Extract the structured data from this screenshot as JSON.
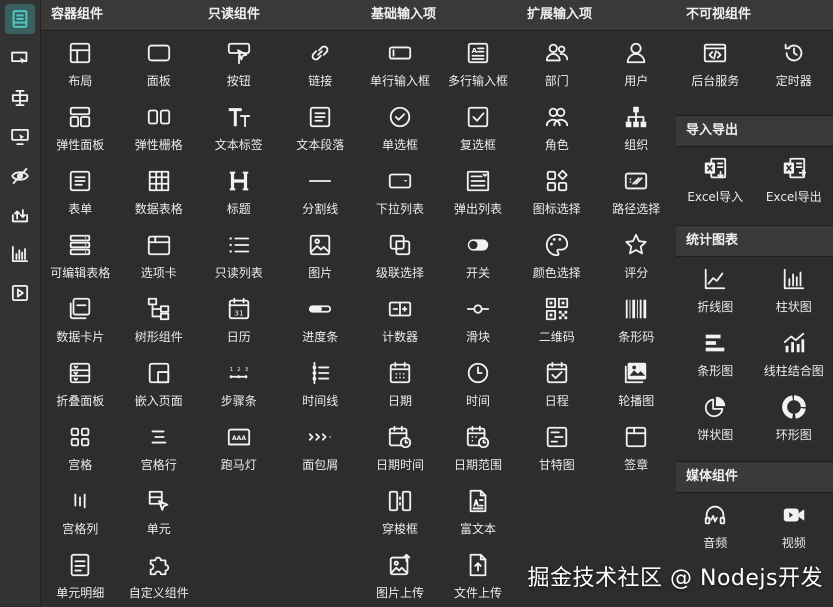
{
  "accent": "#4fc7c0",
  "rail": [
    {
      "icon": "form-designer-icon",
      "active": true
    },
    {
      "icon": "pointer-select-icon",
      "active": false
    },
    {
      "icon": "text-cursor-icon",
      "active": false
    },
    {
      "icon": "screen-click-icon",
      "active": false
    },
    {
      "icon": "eye-off-icon",
      "active": false
    },
    {
      "icon": "import-export-icon",
      "active": false
    },
    {
      "icon": "bar-chart-icon",
      "active": false
    },
    {
      "icon": "media-play-icon",
      "active": false
    }
  ],
  "sections": {
    "container": {
      "title": "容器组件",
      "items": [
        {
          "label": "布局",
          "icon": "layout-icon"
        },
        {
          "label": "面板",
          "icon": "panel-icon"
        },
        {
          "label": "弹性面板",
          "icon": "flex-panel-icon"
        },
        {
          "label": "弹性栅格",
          "icon": "flex-grid-icon"
        },
        {
          "label": "表单",
          "icon": "form-icon"
        },
        {
          "label": "数据表格",
          "icon": "data-table-icon"
        },
        {
          "label": "可编辑表格",
          "icon": "editable-table-icon"
        },
        {
          "label": "选项卡",
          "icon": "tabs-icon"
        },
        {
          "label": "数据卡片",
          "icon": "data-card-icon"
        },
        {
          "label": "树形组件",
          "icon": "tree-icon"
        },
        {
          "label": "折叠面板",
          "icon": "collapse-icon"
        },
        {
          "label": "嵌入页面",
          "icon": "embed-page-icon"
        },
        {
          "label": "宫格",
          "icon": "grid-cells-icon"
        },
        {
          "label": "宫格行",
          "icon": "grid-row-icon"
        },
        {
          "label": "宫格列",
          "icon": "grid-column-icon"
        },
        {
          "label": "单元",
          "icon": "cell-icon"
        },
        {
          "label": "单元明细",
          "icon": "cell-detail-icon"
        },
        {
          "label": "自定义组件",
          "icon": "puzzle-icon"
        }
      ]
    },
    "readonly": {
      "title": "只读组件",
      "items": [
        {
          "label": "按钮",
          "icon": "button-click-icon"
        },
        {
          "label": "链接",
          "icon": "link-icon"
        },
        {
          "label": "文本标签",
          "icon": "text-label-icon"
        },
        {
          "label": "文本段落",
          "icon": "paragraph-icon"
        },
        {
          "label": "标题",
          "icon": "heading-icon"
        },
        {
          "label": "分割线",
          "icon": "divider-icon"
        },
        {
          "label": "只读列表",
          "icon": "list-icon"
        },
        {
          "label": "图片",
          "icon": "image-icon"
        },
        {
          "label": "日历",
          "icon": "calendar-icon"
        },
        {
          "label": "进度条",
          "icon": "progress-icon"
        },
        {
          "label": "步骤条",
          "icon": "steps-icon"
        },
        {
          "label": "时间线",
          "icon": "timeline-icon"
        },
        {
          "label": "跑马灯",
          "icon": "marquee-icon"
        },
        {
          "label": "面包屑",
          "icon": "breadcrumb-icon"
        }
      ]
    },
    "basic": {
      "title": "基础输入项",
      "items": [
        {
          "label": "单行输入框",
          "icon": "input-icon"
        },
        {
          "label": "多行输入框",
          "icon": "textarea-icon"
        },
        {
          "label": "单选框",
          "icon": "radio-icon"
        },
        {
          "label": "复选框",
          "icon": "checkbox-icon"
        },
        {
          "label": "下拉列表",
          "icon": "select-icon"
        },
        {
          "label": "弹出列表",
          "icon": "popup-list-icon"
        },
        {
          "label": "级联选择",
          "icon": "cascader-icon"
        },
        {
          "label": "开关",
          "icon": "switch-icon"
        },
        {
          "label": "计数器",
          "icon": "counter-icon"
        },
        {
          "label": "滑块",
          "icon": "slider-icon"
        },
        {
          "label": "日期",
          "icon": "date-icon"
        },
        {
          "label": "时间",
          "icon": "clock-icon"
        },
        {
          "label": "日期时间",
          "icon": "datetime-icon"
        },
        {
          "label": "日期范围",
          "icon": "date-range-icon"
        },
        {
          "label": "穿梭框",
          "icon": "transfer-icon"
        },
        {
          "label": "富文本",
          "icon": "rich-text-icon"
        },
        {
          "label": "图片上传",
          "icon": "image-upload-icon"
        },
        {
          "label": "文件上传",
          "icon": "file-upload-icon"
        }
      ]
    },
    "extended": {
      "title": "扩展输入项",
      "items": [
        {
          "label": "部门",
          "icon": "department-icon"
        },
        {
          "label": "用户",
          "icon": "user-icon"
        },
        {
          "label": "角色",
          "icon": "role-icon"
        },
        {
          "label": "组织",
          "icon": "org-icon"
        },
        {
          "label": "图标选择",
          "icon": "icon-select-icon"
        },
        {
          "label": "路径选择",
          "icon": "path-select-icon"
        },
        {
          "label": "颜色选择",
          "icon": "palette-icon"
        },
        {
          "label": "评分",
          "icon": "star-icon"
        },
        {
          "label": "二维码",
          "icon": "qrcode-icon"
        },
        {
          "label": "条形码",
          "icon": "barcode-icon"
        },
        {
          "label": "日程",
          "icon": "schedule-icon"
        },
        {
          "label": "轮播图",
          "icon": "carousel-icon"
        },
        {
          "label": "甘特图",
          "icon": "gantt-icon"
        },
        {
          "label": "签章",
          "icon": "seal-icon"
        }
      ]
    },
    "invisible": {
      "title": "不可视组件",
      "items": [
        {
          "label": "后台服务",
          "icon": "backend-service-icon"
        },
        {
          "label": "定时器",
          "icon": "timer-icon"
        }
      ]
    },
    "importexport": {
      "title": "导入导出",
      "items": [
        {
          "label": "Excel导入",
          "icon": "excel-import-icon"
        },
        {
          "label": "Excel导出",
          "icon": "excel-export-icon"
        }
      ]
    },
    "charts": {
      "title": "统计图表",
      "items": [
        {
          "label": "折线图",
          "icon": "line-chart-icon"
        },
        {
          "label": "柱状图",
          "icon": "column-chart-icon"
        },
        {
          "label": "条形图",
          "icon": "horizontal-bar-icon"
        },
        {
          "label": "线柱结合图",
          "icon": "combo-chart-icon"
        },
        {
          "label": "饼状图",
          "icon": "pie-chart-icon"
        },
        {
          "label": "环形图",
          "icon": "donut-chart-icon"
        }
      ]
    },
    "media": {
      "title": "媒体组件",
      "items": [
        {
          "label": "音频",
          "icon": "headphones-icon"
        },
        {
          "label": "视频",
          "icon": "video-icon"
        }
      ]
    }
  },
  "watermark": "掘金技术社区 @ Nodejs开发"
}
